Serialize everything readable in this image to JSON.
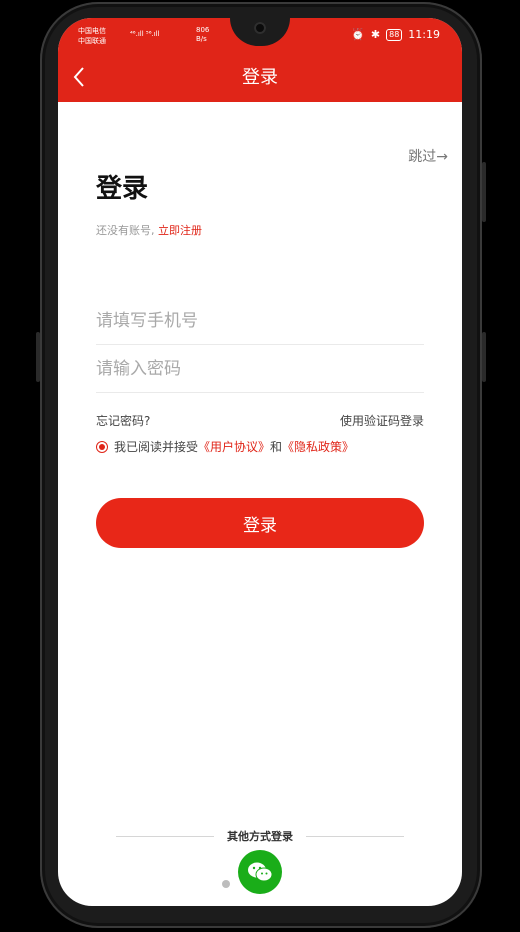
{
  "status_bar": {
    "carrier1": "中国电信",
    "carrier2": "中国联通",
    "signal": "⁴⁶.ıll ⁵⁶.ıll",
    "speed": "806",
    "speed_unit": "B/s",
    "battery": "88",
    "time": "11:19"
  },
  "header": {
    "title": "登录"
  },
  "page": {
    "skip": "跳过→",
    "title": "登录",
    "no_account": "还没有账号,",
    "register_link": "立即注册"
  },
  "form": {
    "phone_placeholder": "请填写手机号",
    "password_placeholder": "请输入密码",
    "forgot": "忘记密码?",
    "sms_login": "使用验证码登录",
    "agree_prefix": "我已阅读并接受",
    "user_agreement": "《用户协议》",
    "and": "和",
    "privacy_policy": "《隐私政策》",
    "login_button": "登录"
  },
  "footer": {
    "other_login": "其他方式登录"
  },
  "colors": {
    "brand_red": "#e02518",
    "wechat_green": "#1aad19"
  }
}
